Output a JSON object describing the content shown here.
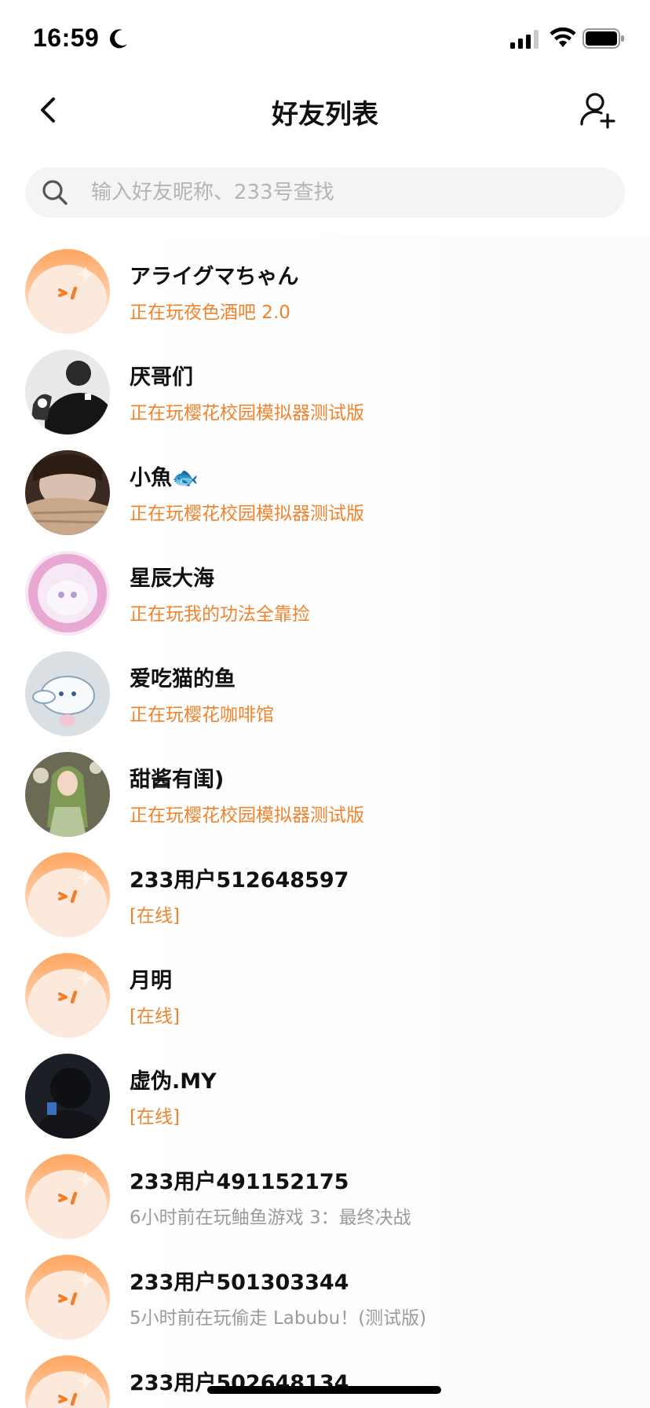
{
  "status_bar": {
    "time": "16:59",
    "moon_icon": "moon-icon",
    "signal_icon": "cellular-signal-icon",
    "wifi_icon": "wifi-icon",
    "battery_icon": "battery-icon"
  },
  "header": {
    "title": "好友列表",
    "back_icon": "chevron-left-icon",
    "add_friend_icon": "add-user-icon"
  },
  "search": {
    "placeholder": "输入好友昵称、233号查找",
    "value": ""
  },
  "colors": {
    "accent_orange": "#f2832c",
    "muted_gray": "#9b9b9f",
    "search_bg": "#f4f4f5"
  },
  "friends": [
    {
      "name": "アライグマちゃん",
      "status": "正在玩夜色酒吧 2.0",
      "status_type": "playing",
      "avatar": "default-avatar"
    },
    {
      "name": "厌哥们",
      "status": "正在玩樱花校园模拟器测试版",
      "status_type": "playing",
      "avatar": "photo-avatar-dark"
    },
    {
      "name": "小魚🐟",
      "status": "正在玩樱花校园模拟器测试版",
      "status_type": "playing",
      "avatar": "photo-avatar-girl"
    },
    {
      "name": "星辰大海",
      "status": "正在玩我的功法全靠捡",
      "status_type": "playing",
      "avatar": "photo-avatar-pink-cat"
    },
    {
      "name": "爱吃猫的鱼",
      "status": "正在玩樱花咖啡馆",
      "status_type": "playing",
      "avatar": "photo-avatar-cinnamoroll"
    },
    {
      "name": "甜酱有闺)",
      "status": "正在玩樱花校园模拟器测试版",
      "status_type": "playing",
      "avatar": "photo-avatar-green-hair"
    },
    {
      "name": "233用户512648597",
      "status": "[在线]",
      "status_type": "online",
      "avatar": "default-avatar"
    },
    {
      "name": "月明",
      "status": "[在线]",
      "status_type": "online",
      "avatar": "default-avatar"
    },
    {
      "name": "虚伪.MY",
      "status": "[在线]",
      "status_type": "online",
      "avatar": "photo-avatar-dark-person"
    },
    {
      "name": "233用户491152175",
      "status": "6小时前在玩鲉鱼游戏 3：最终决战",
      "status_type": "recent",
      "avatar": "default-avatar"
    },
    {
      "name": "233用户501303344",
      "status": "5小时前在玩偷走 Labubu！(测试版)",
      "status_type": "recent",
      "avatar": "default-avatar"
    },
    {
      "name": "233用户502648134",
      "status": "",
      "status_type": "recent",
      "avatar": "default-avatar"
    }
  ]
}
